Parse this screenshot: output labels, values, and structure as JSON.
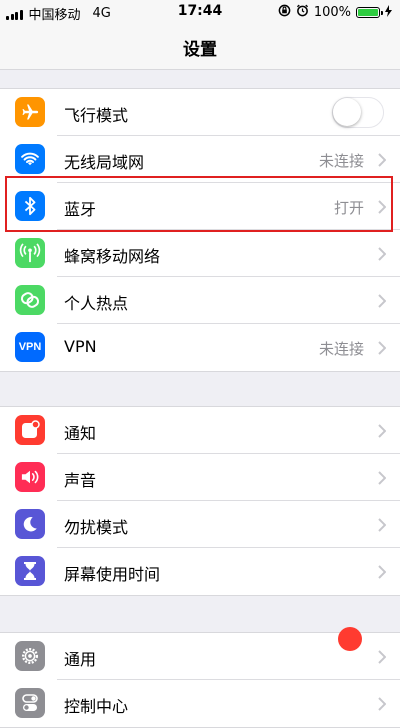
{
  "status_bar": {
    "carrier": "中国移动",
    "network": "4G",
    "time": "17:44",
    "battery_percent": "100%",
    "battery_level": 1.0
  },
  "nav": {
    "title": "设置"
  },
  "group1": [
    {
      "key": "airplane",
      "label": "飞行模式",
      "icon": "airplane-icon",
      "color": "#ff9500",
      "toggle": false
    },
    {
      "key": "wifi",
      "label": "无线局域网",
      "icon": "wifi-icon",
      "color": "#007aff",
      "value": "未连接"
    },
    {
      "key": "bluetooth",
      "label": "蓝牙",
      "icon": "bluetooth-icon",
      "color": "#007aff",
      "value": "打开"
    },
    {
      "key": "cellular",
      "label": "蜂窝移动网络",
      "icon": "antenna-icon",
      "color": "#4cd964"
    },
    {
      "key": "hotspot",
      "label": "个人热点",
      "icon": "hotspot-icon",
      "color": "#4cd964"
    },
    {
      "key": "vpn",
      "label": "VPN",
      "icon": "vpn-icon",
      "icon_text": "VPN",
      "color": "#006aff",
      "value": "未连接"
    }
  ],
  "group2": [
    {
      "key": "notifications",
      "label": "通知",
      "icon": "notifications-icon",
      "color": "#ff3b30"
    },
    {
      "key": "sounds",
      "label": "声音",
      "icon": "speaker-icon",
      "color": "#ff2d55"
    },
    {
      "key": "dnd",
      "label": "勿扰模式",
      "icon": "moon-icon",
      "color": "#5856d6"
    },
    {
      "key": "screentime",
      "label": "屏幕使用时间",
      "icon": "hourglass-icon",
      "color": "#5856d6"
    }
  ],
  "group3": [
    {
      "key": "general",
      "label": "通用",
      "icon": "gear-icon",
      "color": "#8e8e93"
    },
    {
      "key": "control",
      "label": "控制中心",
      "icon": "switches-icon",
      "color": "#8e8e93"
    }
  ],
  "colors": {
    "highlight": "#e02020",
    "chevron": "#c7c7cc"
  }
}
